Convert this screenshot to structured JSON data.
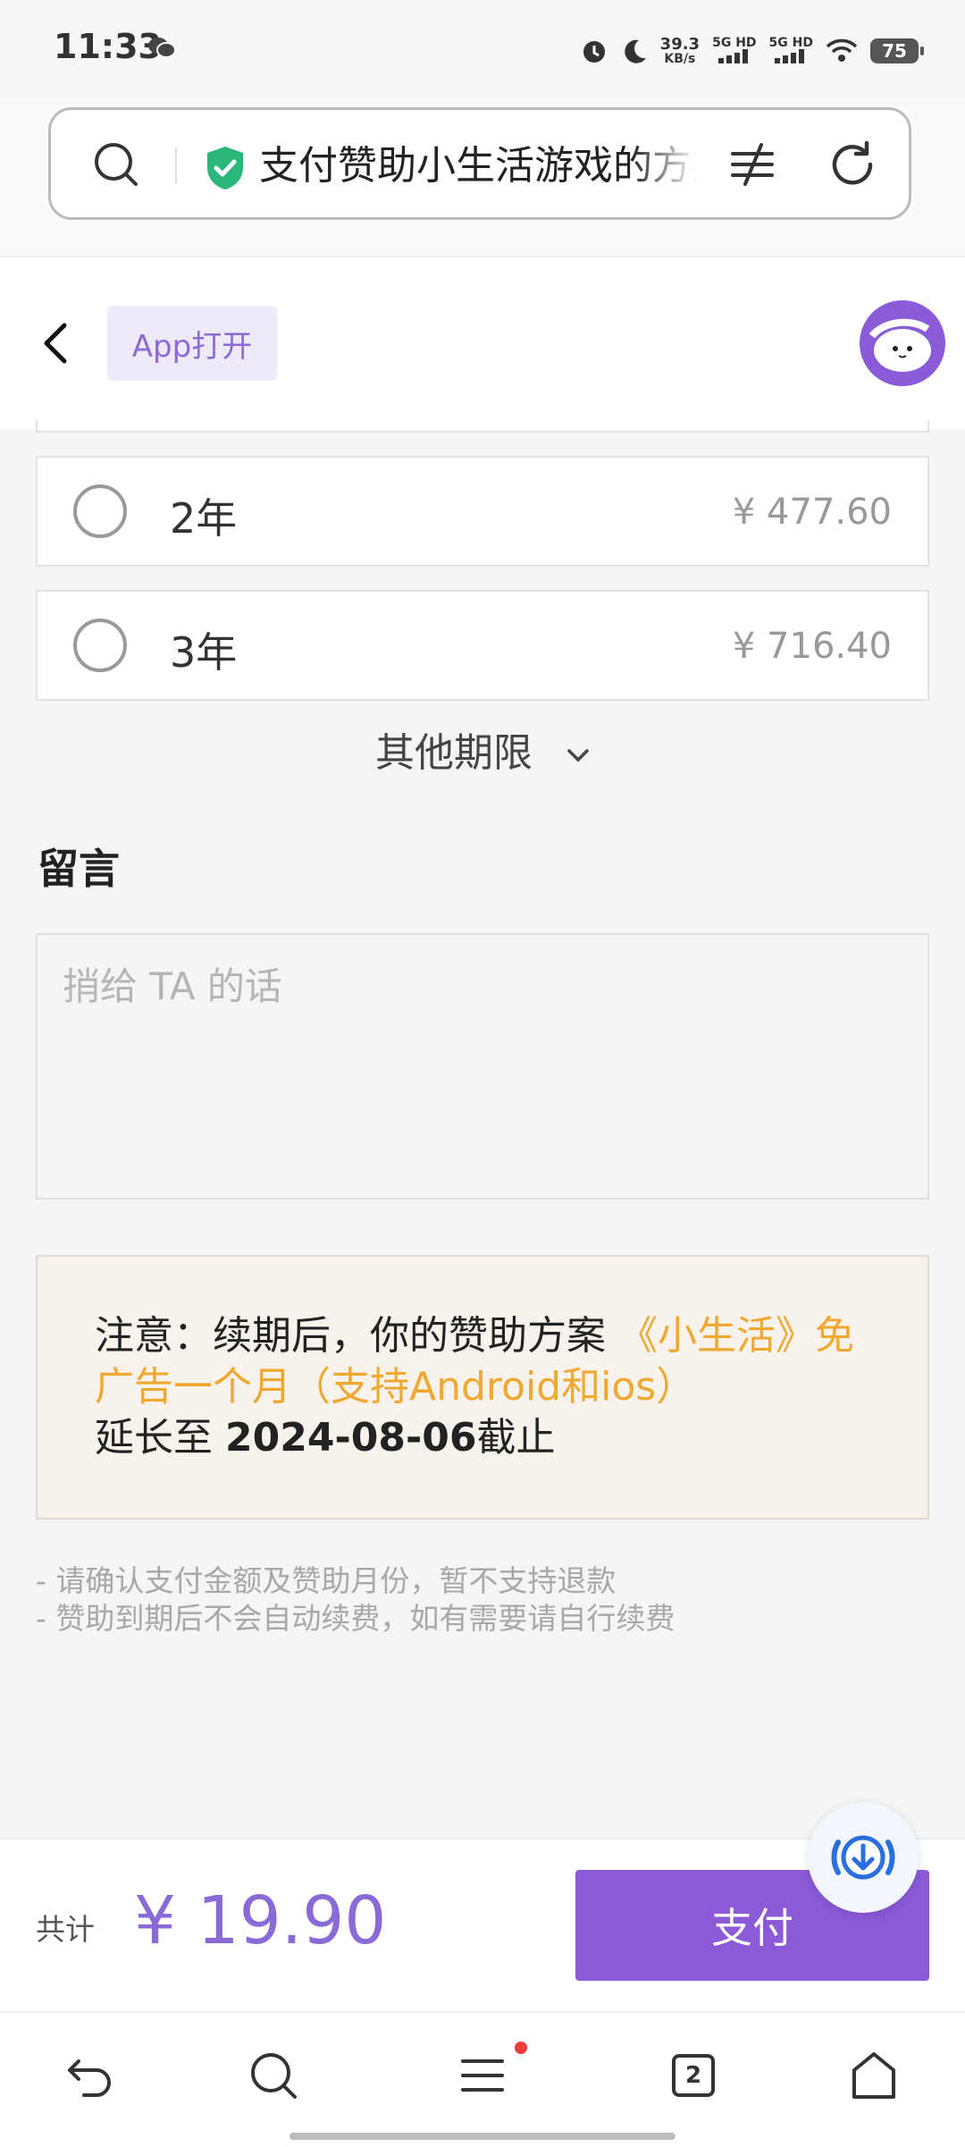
{
  "status_bar": {
    "time": "11:33",
    "net_speed_value": "39.3",
    "net_speed_unit": "KB/s",
    "signal_1": "5G HD",
    "signal_2": "5G HD",
    "battery": "75"
  },
  "url_bar": {
    "title": "支付赞助小生活游戏的方案"
  },
  "header": {
    "app_open_label": "App打开"
  },
  "options": [
    {
      "label": "2年",
      "price": "¥ 477.60"
    },
    {
      "label": "3年",
      "price": "¥ 716.40"
    }
  ],
  "other_period_label": "其他期限",
  "message": {
    "title": "留言",
    "placeholder": "捎给 TA 的话"
  },
  "notice": {
    "prefix": "注意：续期后，你的赞助方案",
    "plan_name": "《小生活》免广告一个月（支持Android和ios）",
    "extend_text": "延长至 ",
    "date": "2024-08-06",
    "suffix": "截止"
  },
  "tips": [
    "- 请确认支付金额及赞助月份，暂不支持退款",
    "- 赞助到期后不会自动续费，如有需要请自行续费"
  ],
  "pay_bar": {
    "total_label": "共计",
    "total_amount": "¥  19.90",
    "pay_button_label": "支付"
  },
  "nav": {
    "tab_count": "2"
  },
  "colors": {
    "accent": "#8a5ad8",
    "highlight": "#f0a830"
  }
}
